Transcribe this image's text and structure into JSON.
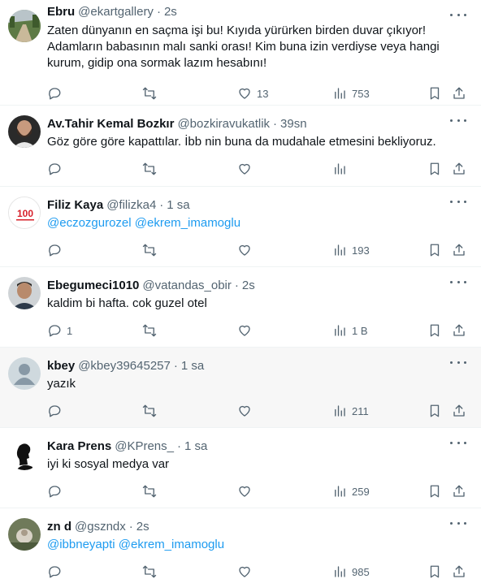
{
  "tweets": [
    {
      "name": "Ebru",
      "handle": "@ekartgallery",
      "time": "2s",
      "text": "Zaten dünyanın en saçma işi bu! Kıyıda yürürken birden duvar çıkıyor!\nAdamların babasının malı sanki orası! Kim buna izin verdiyse veya hangi\nkurum, gidip ona sormak lazım hesabını!",
      "replies": "",
      "retweets": "",
      "likes": "13",
      "views": "753",
      "avatar": "landscape-photo"
    },
    {
      "name": "Av.Tahir Kemal Bozkır",
      "handle": "@bozkiravukatlik",
      "time": "39sn",
      "text": "Göz göre göre kapattılar. İbb nin buna da mudahale etmesini bekliyoruz.",
      "replies": "",
      "retweets": "",
      "likes": "",
      "views": "",
      "avatar": "man-photo"
    },
    {
      "name": "Filiz Kaya",
      "handle": "@filizka4",
      "time": "1 sa",
      "text": "",
      "mentions": "@eczozgurozel @ekrem_imamoglu",
      "replies": "",
      "retweets": "",
      "likes": "",
      "views": "193",
      "avatar": "100-logo"
    },
    {
      "name": "Ebegumeci1010",
      "handle": "@vatandas_obir",
      "time": "2s",
      "text": "kaldim bi hafta. cok guzel otel",
      "replies": "1",
      "retweets": "",
      "likes": "",
      "views": "1 B",
      "avatar": "man-photo-2"
    },
    {
      "name": "kbey",
      "handle": "@kbey39645257",
      "time": "1 sa",
      "text": "yazık",
      "replies": "",
      "retweets": "",
      "likes": "",
      "views": "211",
      "avatar": "default-avatar"
    },
    {
      "name": "Kara Prens",
      "handle": "@KPrens_",
      "time": "1 sa",
      "text": "iyi ki sosyal medya var",
      "replies": "",
      "retweets": "",
      "likes": "",
      "views": "259",
      "avatar": "silhouette"
    },
    {
      "name": "zn d",
      "handle": "@gszndx",
      "time": "2s",
      "text": "",
      "mentions": "@ibbneyapti @ekrem_imamoglu",
      "replies": "",
      "retweets": "",
      "likes": "",
      "views": "985",
      "avatar": "small-photo"
    }
  ],
  "separator": "·",
  "logo_text": "100"
}
